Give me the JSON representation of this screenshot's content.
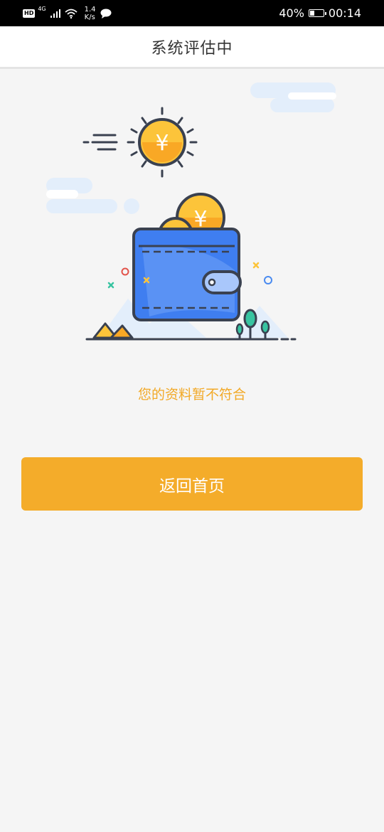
{
  "status_bar": {
    "hd_label": "HD",
    "network_gen": "4G",
    "speed_value": "1.4",
    "speed_unit": "K/s",
    "battery_percent": "40%",
    "battery_level": 0.4,
    "time": "00:14"
  },
  "header": {
    "title": "系统评估中"
  },
  "illustration": {
    "currency_symbol": "¥"
  },
  "result": {
    "message": "您的资料暂不符合"
  },
  "actions": {
    "home_button_label": "返回首页"
  },
  "colors": {
    "accent": "#f4ac2a",
    "message_text": "#f2a927",
    "wallet_blue": "#3f7ef0",
    "background": "#f5f5f5"
  }
}
